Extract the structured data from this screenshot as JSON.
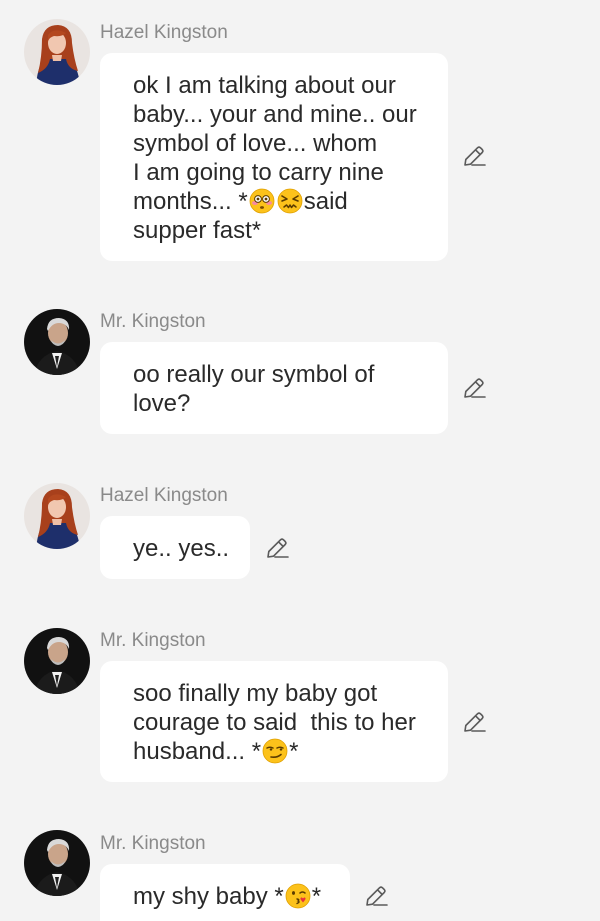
{
  "messages": [
    {
      "sender": "Hazel Kingston",
      "avatar": "woman-red-hair-avatar",
      "lines": [
        [
          "ok I am talking about our"
        ],
        [
          "baby... your and mine.. our"
        ],
        [
          "symbol of love... whom"
        ],
        [
          "I am going to carry nine"
        ],
        [
          "months... *",
          "flushed-face-emoji",
          "confounded-face-emoji",
          "said"
        ],
        [
          "supper fast*"
        ]
      ]
    },
    {
      "sender": "Mr. Kingston",
      "avatar": "man-suit-avatar",
      "lines": [
        [
          "oo really our symbol of"
        ],
        [
          "love?"
        ]
      ]
    },
    {
      "sender": "Hazel Kingston",
      "avatar": "woman-red-hair-avatar",
      "lines": [
        [
          "ye.. yes.."
        ]
      ]
    },
    {
      "sender": "Mr. Kingston",
      "avatar": "man-suit-avatar",
      "lines": [
        [
          "soo finally my baby got"
        ],
        [
          "courage to said  this to her"
        ],
        [
          "husband... *",
          "smirking-face-emoji",
          "*"
        ]
      ]
    },
    {
      "sender": "Mr. Kingston",
      "avatar": "man-suit-avatar",
      "lines": [
        [
          "my shy baby *",
          "kissing-face-emoji",
          "*"
        ]
      ]
    }
  ],
  "icons": {
    "edit": "pencil-edit-icon"
  },
  "colors": {
    "background": "#f3f3f3",
    "bubble": "#ffffff",
    "name_text": "#8a8a8a",
    "message_text": "#2a2a2a"
  }
}
